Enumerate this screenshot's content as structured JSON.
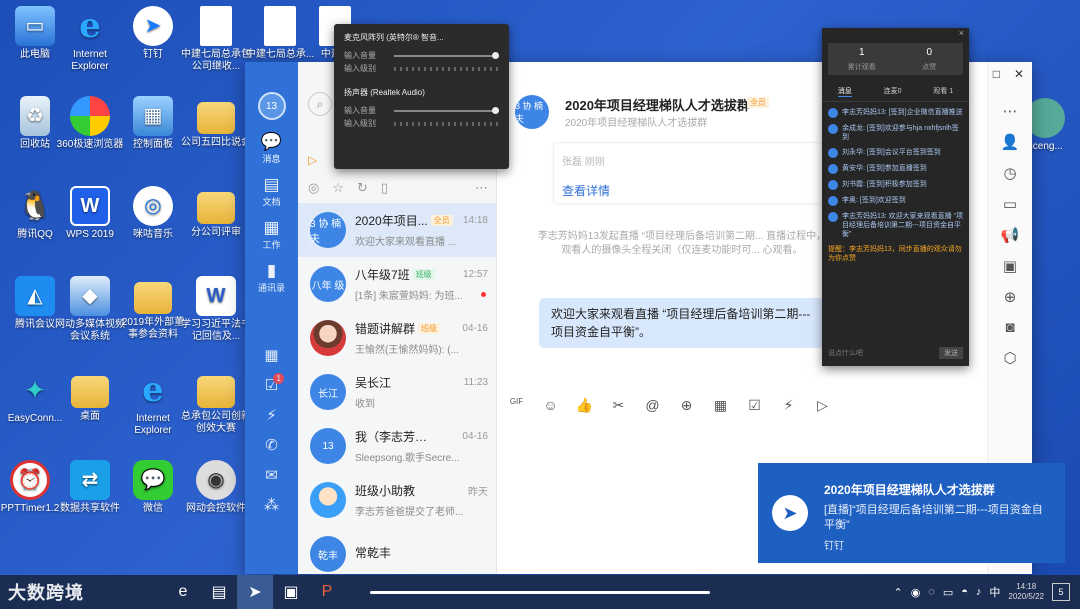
{
  "desktop": {
    "icons": [
      {
        "label": "此电脑",
        "glyph": "▭"
      },
      {
        "label": "Internet Explorer",
        "glyph": "e"
      },
      {
        "label": "钉钉",
        "glyph": "➤"
      },
      {
        "label": "中建七局总承包公司继收...",
        "glyph": ""
      },
      {
        "label": "中建七局总承...",
        "glyph": ""
      },
      {
        "label": "中建...",
        "glyph": ""
      },
      {
        "label": "回收站",
        "glyph": "♻"
      },
      {
        "label": "360极速浏览器",
        "glyph": ""
      },
      {
        "label": "控制面板",
        "glyph": "▦"
      },
      {
        "label": "公司五四比说会",
        "glyph": ""
      },
      {
        "label": "腾讯QQ",
        "glyph": "🐧"
      },
      {
        "label": "WPS 2019",
        "glyph": "W"
      },
      {
        "label": "咪咕音乐",
        "glyph": "◎"
      },
      {
        "label": "分公司评审",
        "glyph": ""
      },
      {
        "label": "腾讯会议",
        "glyph": "◭"
      },
      {
        "label": "网动多媒体视频会议系统",
        "glyph": "◆"
      },
      {
        "label": "2019年外部董事参会资料",
        "glyph": ""
      },
      {
        "label": "学习习近平法书记回信及...",
        "glyph": "W"
      },
      {
        "label": "EasyConn...",
        "glyph": "✦"
      },
      {
        "label": "桌面",
        "glyph": ""
      },
      {
        "label": "Internet Explorer",
        "glyph": "e"
      },
      {
        "label": "总承包公司创新创效大赛",
        "glyph": ""
      },
      {
        "label": "PPTTimer1.2",
        "glyph": "⏰"
      },
      {
        "label": "数据共享软件",
        "glyph": "⇄"
      },
      {
        "label": "微信",
        "glyph": "💬"
      },
      {
        "label": "网动会控软件",
        "glyph": "◉"
      }
    ],
    "right_icon_label": "gceng..."
  },
  "sidebar": {
    "avatar_text": "13",
    "nav": [
      {
        "label": "消息",
        "glyph": "💬"
      },
      {
        "label": "文档",
        "glyph": "▤"
      },
      {
        "label": "工作",
        "glyph": "▦"
      },
      {
        "label": "通讯录",
        "glyph": "▮"
      }
    ],
    "tools_badge": "1"
  },
  "conversations": [
    {
      "avatar": "3 协 楠 夫",
      "name": "2020年项目...",
      "tag": "全员",
      "tag_color": "orange",
      "time": "14:18",
      "preview": "欢迎大家来观看直播 ...",
      "selected": true,
      "unread": false,
      "avatar_style": ""
    },
    {
      "avatar": "八年 级",
      "name": "八年级7班",
      "tag": "班级",
      "tag_color": "green",
      "time": "12:57",
      "preview": "[1条] 朱宸萱妈妈: 为班...",
      "selected": false,
      "unread": true,
      "avatar_style": ""
    },
    {
      "avatar": "",
      "name": "错题讲解群",
      "tag": "班级",
      "tag_color": "orange",
      "time": "04-16",
      "preview": "王愉然(王愉然妈妈): (...",
      "selected": false,
      "unread": false,
      "avatar_style": "photo"
    },
    {
      "avatar": "长江",
      "name": "吴长江",
      "tag": "",
      "tag_color": "",
      "time": "11:23",
      "preview": "收到",
      "selected": false,
      "unread": false,
      "avatar_style": ""
    },
    {
      "avatar": "13",
      "name": "我（李志芳妈妈）",
      "tag": "",
      "tag_color": "",
      "time": "04-16",
      "preview": "Sleepsong.歌手Secre...",
      "selected": false,
      "unread": false,
      "avatar_style": ""
    },
    {
      "avatar": "",
      "name": "班级小助教",
      "tag": "",
      "tag_color": "",
      "time": "昨天",
      "preview": "李志芳爸爸提交了老师...",
      "selected": false,
      "unread": false,
      "avatar_style": "helper"
    },
    {
      "avatar": "乾丰",
      "name": "常乾丰",
      "tag": "",
      "tag_color": "",
      "time": "",
      "preview": "",
      "selected": false,
      "unread": false,
      "avatar_style": ""
    }
  ],
  "chat": {
    "avatar": "3 协 楠 夫",
    "title": "2020年项目经理梯队人才选拔群",
    "tag": "全员",
    "subtitle": "2020年项目经理梯队人才选拔群",
    "card_hint": "张磊 刚刚",
    "card_link": "查看详情",
    "system_message": "李志芳妈妈13发起直播 “项目经理后备培训第二期... 直播过程中，观看人的摄像头全程关闭（仅连麦功能时可... 心观看。",
    "bubble": "欢迎大家来观看直播 “项目经理后备培训第二期---项目资金自平衡”。",
    "tools": [
      "GIF",
      "☺",
      "👍",
      "✂",
      "@",
      "⊕",
      "▦",
      "☑",
      "⚡",
      "▷"
    ]
  },
  "right_bar": [
    "⋯",
    "👤",
    "◷",
    "▭",
    "📢",
    "▣",
    "⊕",
    "◙",
    "⬡"
  ],
  "window_controls": [
    "□",
    "✕"
  ],
  "audio_popup": {
    "mic_header": "麦克风阵列 (英特尔® 智音...",
    "input_volume": "输入音量",
    "input_level": "输入级别",
    "speaker_header": "扬声器 (Realtek Audio)",
    "output_volume": "输入音量",
    "output_level": "输入级别"
  },
  "live_panel": {
    "close": "×",
    "stats": [
      {
        "num": "1",
        "cap": "累计观看"
      },
      {
        "num": "0",
        "cap": "点赞"
      }
    ],
    "tabs": [
      "消息",
      "连麦0",
      "观看 1"
    ],
    "messages": [
      "李志芳妈妈13: [签到]企业微信直播推送",
      "余成龙: [签到]欢迎参与hja nxhfjsnlh签到",
      "刘永华: [签到]会议平台签到签到",
      "黄安华: [签到]参加直播签到",
      "刘书霞: [签到]积极参加签到",
      "李奥: [签到]欢迎签到",
      "李志芳妈妈13: 欢迎大家来观看直播 “项目经理后备培训第二期---项目资金自平衡”"
    ],
    "warning": "提醒：李志芳妈妈13，同步直播的观众请勿为你点赞",
    "input_placeholder": "说点什么吧",
    "send": "发送"
  },
  "toast": {
    "title": "2020年项目经理梯队人才选拔群",
    "body": "[直播]“项目经理后备培训第二期---项目资金自平衡”",
    "source": "钉钉"
  },
  "taskbar": {
    "brand": "大数跨境",
    "items": [
      "e",
      "▤",
      "➤",
      "▣",
      "P"
    ],
    "clock_time": "14:18",
    "clock_date": "2020/5/22",
    "tray": [
      "⌃",
      "◉",
      "◌",
      "▭",
      "◓",
      "♪",
      "中"
    ],
    "notif_count": "5"
  }
}
